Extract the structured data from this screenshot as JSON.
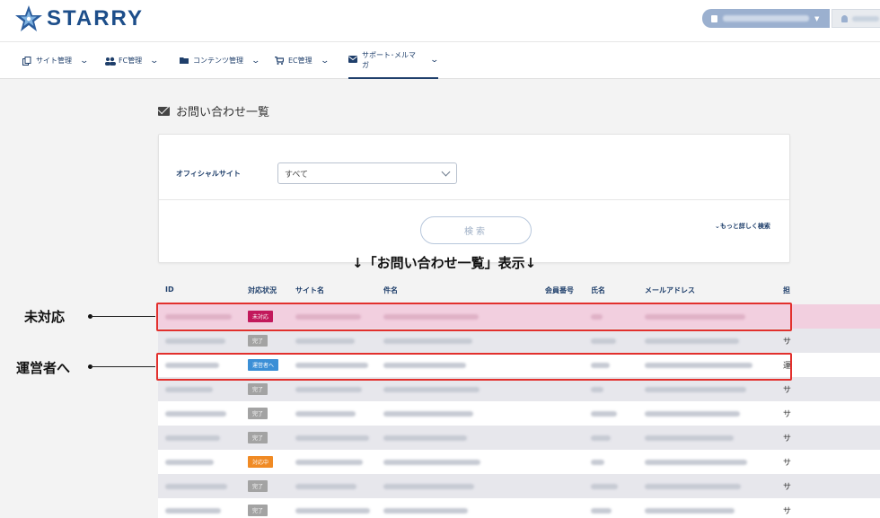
{
  "header": {
    "brand": "STARRY",
    "colors": {
      "brand": "#1d4e8a",
      "pill": "#9bb0cf"
    }
  },
  "nav": [
    {
      "label": "サイト管理",
      "icon": "copy-icon"
    },
    {
      "label": "FC管理",
      "icon": "users-icon"
    },
    {
      "label": "コンテンツ管理",
      "icon": "folder-icon"
    },
    {
      "label": "EC管理",
      "icon": "cart-icon"
    },
    {
      "label": "サポート･メルマガ",
      "icon": "envelope-icon",
      "active": true
    }
  ],
  "page": {
    "title": "お問い合わせ一覧"
  },
  "search": {
    "site_label": "オフィシャルサイト",
    "site_value": "すべて",
    "button_label": "検索",
    "advanced_link": "⌄もっと詳しく検索"
  },
  "annotations": {
    "center": "↓「お問い合わせ一覧」表示↓",
    "unhandled": "未対応",
    "to_operator": "運営者へ"
  },
  "table": {
    "columns": [
      "ID",
      "対応状況",
      "サイト名",
      "件名",
      "会員番号",
      "氏名",
      "メールアドレス",
      "担"
    ],
    "rows": [
      {
        "status": "未対応",
        "status_color": "#c2185b",
        "edge": "",
        "highlight": true
      },
      {
        "status": "完了",
        "status_color": "#a3a3a3",
        "edge": "サ"
      },
      {
        "status": "運営者へ",
        "status_color": "#3b8fd6",
        "edge": "運"
      },
      {
        "status": "完了",
        "status_color": "#a3a3a3",
        "edge": "サ"
      },
      {
        "status": "完了",
        "status_color": "#a3a3a3",
        "edge": "サ"
      },
      {
        "status": "完了",
        "status_color": "#a3a3a3",
        "edge": "サ"
      },
      {
        "status": "対応中",
        "status_color": "#f08a24",
        "edge": "サ"
      },
      {
        "status": "完了",
        "status_color": "#a3a3a3",
        "edge": "サ"
      },
      {
        "status": "完了",
        "status_color": "#a3a3a3",
        "edge": "サ"
      }
    ]
  }
}
